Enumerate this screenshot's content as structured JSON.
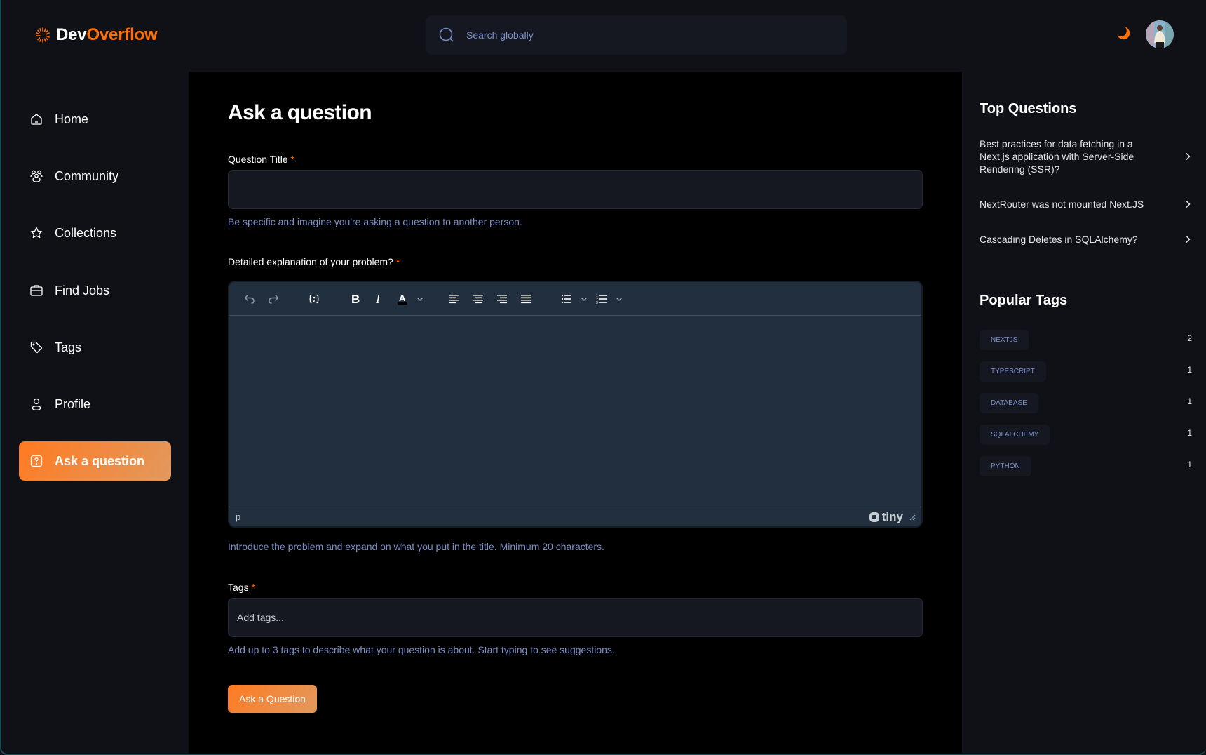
{
  "brand": {
    "name_part1": "Dev",
    "name_part2": "Overflow",
    "accent": "#ff7000"
  },
  "header": {
    "search_placeholder": "Search globally",
    "theme_icon": "moon-icon",
    "avatar_alt": "User avatar"
  },
  "sidebar": {
    "items": [
      {
        "label": "Home",
        "icon": "home-icon",
        "active": false
      },
      {
        "label": "Community",
        "icon": "users-icon",
        "active": false
      },
      {
        "label": "Collections",
        "icon": "star-icon",
        "active": false
      },
      {
        "label": "Find Jobs",
        "icon": "briefcase-icon",
        "active": false
      },
      {
        "label": "Tags",
        "icon": "tag-icon",
        "active": false
      },
      {
        "label": "Profile",
        "icon": "user-icon",
        "active": false
      },
      {
        "label": "Ask a question",
        "icon": "question-icon",
        "active": true
      }
    ]
  },
  "main": {
    "title": "Ask a question",
    "title_field": {
      "label": "Question Title",
      "required_mark": "*",
      "value": "",
      "placeholder": "",
      "hint": "Be specific and imagine you're asking a question to another person."
    },
    "explanation_field": {
      "label": "Detailed explanation of your problem?",
      "required_mark": "*",
      "hint": "Introduce the problem and expand on what you put in the title. Minimum 20 characters.",
      "editor": {
        "toolbar": [
          "undo",
          "redo",
          "codesample",
          "bold",
          "italic",
          "forecolor",
          "align-left",
          "align-center",
          "align-right",
          "align-justify",
          "bullet-list",
          "numbered-list"
        ],
        "status_path": "p",
        "brand": "tiny"
      }
    },
    "tags_field": {
      "label": "Tags",
      "required_mark": "*",
      "value": "",
      "placeholder": "Add tags...",
      "hint": "Add up to 3 tags to describe what your question is about. Start typing to see suggestions."
    },
    "submit_label": "Ask a Question"
  },
  "rightbar": {
    "top_questions_title": "Top Questions",
    "top_questions": [
      "Best practices for data fetching in a Next.js application with Server-Side Rendering (SSR)?",
      "NextRouter was not mounted Next.JS",
      "Cascading Deletes in SQLAlchemy?"
    ],
    "popular_tags_title": "Popular Tags",
    "popular_tags": [
      {
        "name": "NEXTJS",
        "count": "2"
      },
      {
        "name": "TYPESCRIPT",
        "count": "1"
      },
      {
        "name": "DATABASE",
        "count": "1"
      },
      {
        "name": "SQLALCHEMY",
        "count": "1"
      },
      {
        "name": "PYTHON",
        "count": "1"
      }
    ]
  }
}
